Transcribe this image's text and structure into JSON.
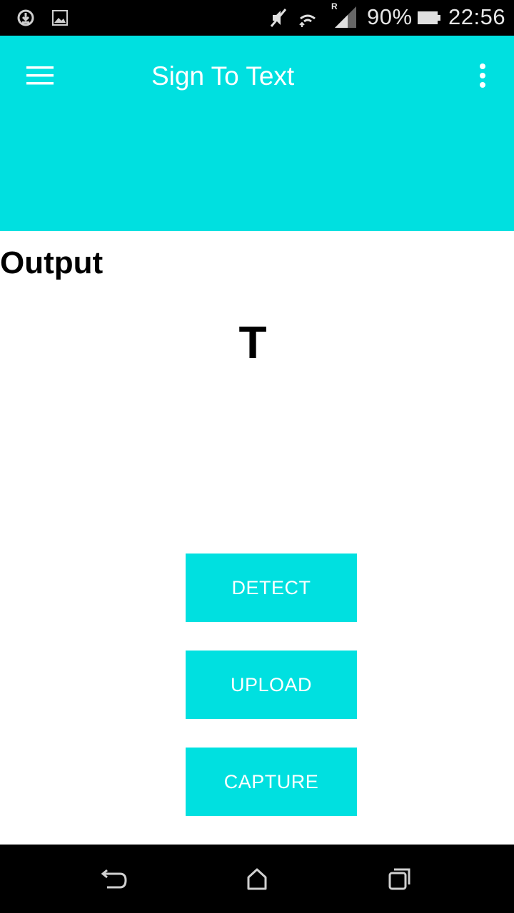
{
  "status_bar": {
    "battery_percent": "90%",
    "time": "22:56",
    "roaming_indicator": "R",
    "icons": [
      "sync-icon",
      "image-icon",
      "mute-icon",
      "wifi-icon",
      "signal-icon",
      "battery-icon"
    ]
  },
  "app_bar": {
    "title": "Sign To Text",
    "menu_icon": "hamburger-menu-icon",
    "overflow_icon": "more-vert-icon"
  },
  "content": {
    "output_label": "Output",
    "output_value": "T"
  },
  "actions": {
    "detect_label": "DETECT",
    "upload_label": "UPLOAD",
    "capture_label": "CAPTURE"
  },
  "nav_bar": {
    "icons": [
      "back-icon",
      "home-icon",
      "recents-icon"
    ]
  },
  "colors": {
    "accent": "#00e0e0",
    "status_bar": "#000000",
    "nav_bar": "#000000",
    "button_text": "#ffffff"
  }
}
